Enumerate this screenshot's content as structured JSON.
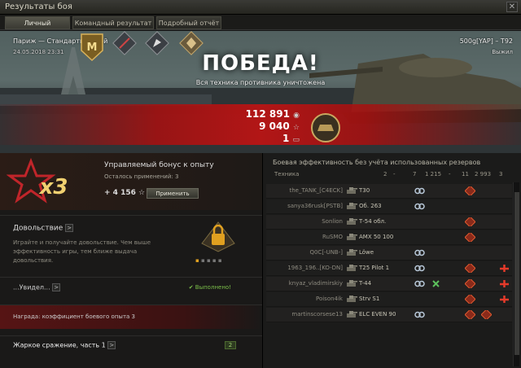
{
  "window": {
    "title": "Результаты боя",
    "close": "✕"
  },
  "tabs": [
    {
      "label": "Личный результат",
      "active": true
    },
    {
      "label": "Командный результат",
      "active": false
    },
    {
      "label": "Подробный отчёт",
      "active": false
    }
  ],
  "hero": {
    "map_mode": "Париж — Стандартный бой",
    "datetime": "24.05.2018 23:31",
    "player_tank": "500g[YAP] – T92",
    "status": "Выжил",
    "result": "ПОБЕДА!",
    "result_sub": "Вся техника противника уничтожена",
    "credits": "112 891",
    "xp": "9 040",
    "bonds": "1",
    "medals": [
      "mastery-m-badge",
      "medal-2",
      "medal-3",
      "medal-4",
      "special-medal"
    ]
  },
  "bonus": {
    "multiplier": "x3",
    "title": "Управляемый бонус к опыту",
    "remaining_label": "Осталось применений:",
    "remaining_value": "3",
    "xp_value": "+ 4 156",
    "apply_button": "Применить"
  },
  "satisfaction": {
    "title": "Довольствие",
    "arrow": ">",
    "description": "Играйте и получайте довольствие. Чем выше эффективность игры, тем ближе выдача довольствия."
  },
  "quest1": {
    "title": "...Увидел...",
    "arrow": ">",
    "status": "✔ Выполнено!"
  },
  "reward": {
    "label": "Награда:",
    "value": "коэффициент боевого опыта 3"
  },
  "quest2": {
    "title": "Жаркое сражение, часть 1",
    "arrow": ">",
    "badge": "2"
  },
  "efficiency": {
    "header": "Боевая эффективность без учёта использованных резервов",
    "col_vehicle": "Техника",
    "col_values": [
      "2",
      "-",
      "7",
      "1 215",
      "-",
      "11",
      "2 993",
      "3"
    ],
    "rows": [
      {
        "player": "the_TANK_[C4ECK]",
        "tank": "T30"
      },
      {
        "player": "sanya36rusk[PSTB]",
        "tank": "Об. 263"
      },
      {
        "player": "Sonlion",
        "tank": "Т-54 обл."
      },
      {
        "player": "RuSMO",
        "tank": "AMX 50 100"
      },
      {
        "player": "Q0C[-UNB-]",
        "tank": "Löwe"
      },
      {
        "player": "1963_196..[KO-DN]",
        "tank": "T25 Pilot 1"
      },
      {
        "player": "knyaz_vladimirskiy",
        "tank": "T-44"
      },
      {
        "player": "Poison4ik",
        "tank": "Strv S1"
      },
      {
        "player": "martinscorsese13",
        "tank": "ELC EVEN 90"
      }
    ]
  },
  "colors": {
    "accent_red": "#b31414",
    "gold": "#d9b25a"
  }
}
